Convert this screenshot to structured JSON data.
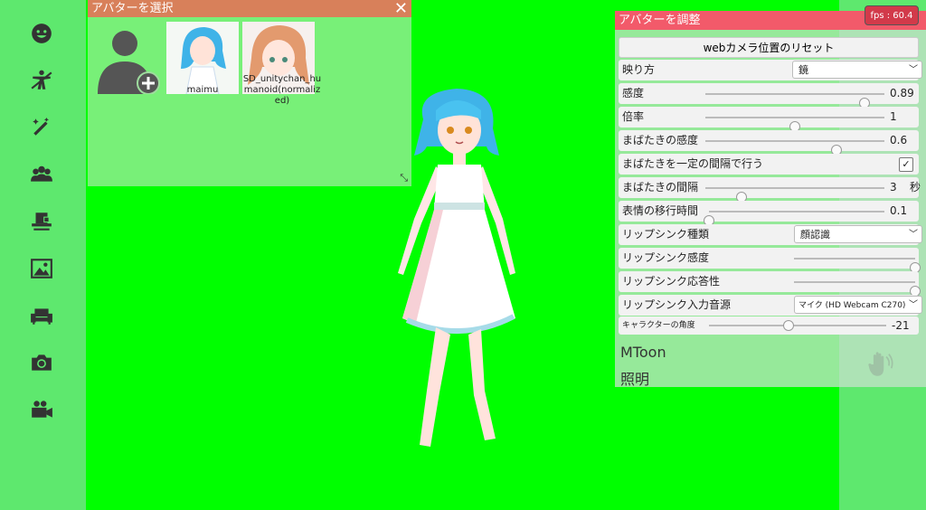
{
  "sidebar": {
    "items": [
      {
        "icon": "face-icon"
      },
      {
        "icon": "pose-icon"
      },
      {
        "icon": "magic-wand-icon"
      },
      {
        "icon": "people-icon"
      },
      {
        "icon": "hat-icon"
      },
      {
        "icon": "image-icon"
      },
      {
        "icon": "sofa-icon"
      },
      {
        "icon": "camera-icon"
      },
      {
        "icon": "video-camera-icon"
      }
    ]
  },
  "avatar_select": {
    "title": "アバターを選択",
    "close": "✕",
    "avatars": [
      {
        "label": "maimu"
      },
      {
        "label": "SD_unitychan_humanoid(normalized)"
      }
    ]
  },
  "adjust": {
    "title": "アバターを調整",
    "reset_label": "webカメラ位置のリセット",
    "rows": {
      "mirror": {
        "label": "映り方",
        "value": "鏡"
      },
      "sensitivity": {
        "label": "感度",
        "value": "0.89",
        "fraction": 0.89
      },
      "scale": {
        "label": "倍率",
        "value": "1",
        "fraction": 0.5
      },
      "blink_sensitivity": {
        "label": "まばたきの感度",
        "value": "0.6",
        "fraction": 0.73
      },
      "blink_constant": {
        "label": "まばたきを一定の間隔で行う",
        "checked": "✓"
      },
      "blink_interval": {
        "label": "まばたきの間隔",
        "value": "3",
        "unit": "秒",
        "fraction": 0.2
      },
      "expression_time": {
        "label": "表情の移行時間",
        "value": "0.1",
        "fraction": 0.0
      },
      "lipsync_type": {
        "label": "リップシンク種類",
        "value": "顔認識"
      },
      "lipsync_sensitivity": {
        "label": "リップシンク感度",
        "fraction": 1.0
      },
      "lipsync_response": {
        "label": "リップシンク応答性",
        "fraction": 1.0
      },
      "lipsync_source": {
        "label": "リップシンク入力音源",
        "value": "マイク (HD Webcam C270)"
      },
      "character_angle": {
        "label": "キャラクターの角度",
        "value": "-21",
        "fraction": 0.45
      }
    },
    "section_mtoon": "MToon",
    "section_light": "照明"
  },
  "fps": "fps : 60.4",
  "colors": {
    "background": "#00ff00",
    "sidebar": "#5ee86e",
    "select_title": "#d8805a",
    "adjust_title": "#f25a6a"
  }
}
